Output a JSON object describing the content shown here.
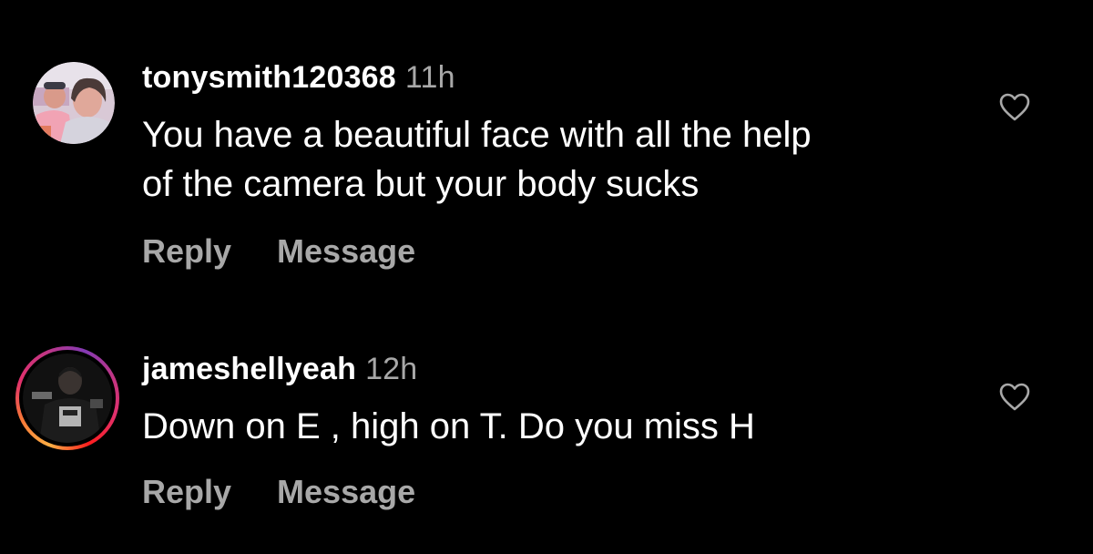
{
  "comments": [
    {
      "username": "tonysmith120368",
      "time": "11h",
      "text_line1": "You have a beautiful face with all the help",
      "text_line2": "of the camera but your body sucks",
      "reply_label": "Reply",
      "message_label": "Message",
      "like_icon": "heart-outline-icon",
      "has_story_ring": false
    },
    {
      "username": "jameshellyeah",
      "time": "12h",
      "text_line1": "Down on E , high on T. Do you miss H",
      "reply_label": "Reply",
      "message_label": "Message",
      "like_icon": "heart-outline-icon",
      "has_story_ring": true
    }
  ],
  "colors": {
    "background": "#000000",
    "primary_text": "#ffffff",
    "secondary_text": "#a8a8a8",
    "story_ring": [
      "#fcaf45",
      "#f77737",
      "#e1306c",
      "#c13584",
      "#833ab4"
    ]
  }
}
